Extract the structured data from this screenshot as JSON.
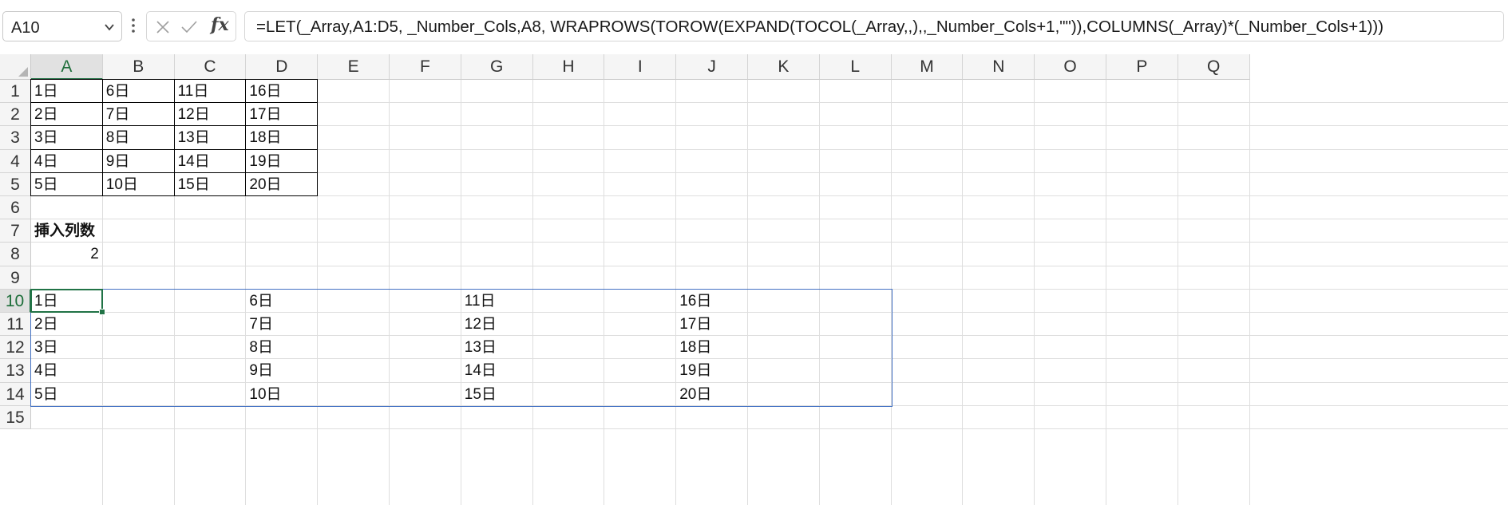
{
  "name_box": {
    "value": "A10"
  },
  "formula_bar": {
    "formula": "=LET(_Array,A1:D5, _Number_Cols,A8, WRAPROWS(TOROW(EXPAND(TOCOL(_Array,,),,_Number_Cols+1,\"\")),COLUMNS(_Array)*(_Number_Cols+1)))",
    "fx_label": "fx"
  },
  "columns": [
    "A",
    "B",
    "C",
    "D",
    "E",
    "F",
    "G",
    "H",
    "I",
    "J",
    "K",
    "L",
    "M",
    "N",
    "O",
    "P",
    "Q"
  ],
  "rows": [
    "1",
    "2",
    "3",
    "4",
    "5",
    "6",
    "7",
    "8",
    "9",
    "10",
    "11",
    "12",
    "13",
    "14",
    "15"
  ],
  "active_cell": {
    "col": "A",
    "row": "10"
  },
  "source_table": [
    [
      "1日",
      "6日",
      "11日",
      "16日"
    ],
    [
      "2日",
      "7日",
      "12日",
      "17日"
    ],
    [
      "3日",
      "8日",
      "13日",
      "18日"
    ],
    [
      "4日",
      "9日",
      "14日",
      "19日"
    ],
    [
      "5日",
      "10日",
      "15日",
      "20日"
    ]
  ],
  "label_cell": {
    "ref": "A7",
    "text": "挿入列数"
  },
  "input_cell": {
    "ref": "A8",
    "value": "2"
  },
  "result_table": [
    [
      "1日",
      "",
      "",
      "6日",
      "",
      "",
      "11日",
      "",
      "",
      "16日",
      "",
      ""
    ],
    [
      "2日",
      "",
      "",
      "7日",
      "",
      "",
      "12日",
      "",
      "",
      "17日",
      "",
      ""
    ],
    [
      "3日",
      "",
      "",
      "8日",
      "",
      "",
      "13日",
      "",
      "",
      "18日",
      "",
      ""
    ],
    [
      "4日",
      "",
      "",
      "9日",
      "",
      "",
      "14日",
      "",
      "",
      "19日",
      "",
      ""
    ],
    [
      "5日",
      "",
      "",
      "10日",
      "",
      "",
      "15日",
      "",
      "",
      "20日",
      "",
      ""
    ]
  ],
  "colors": {
    "selection_green": "#217346",
    "spill_blue": "#4472c4",
    "header_bg": "#f5f5f5",
    "gridline": "#dedede"
  }
}
